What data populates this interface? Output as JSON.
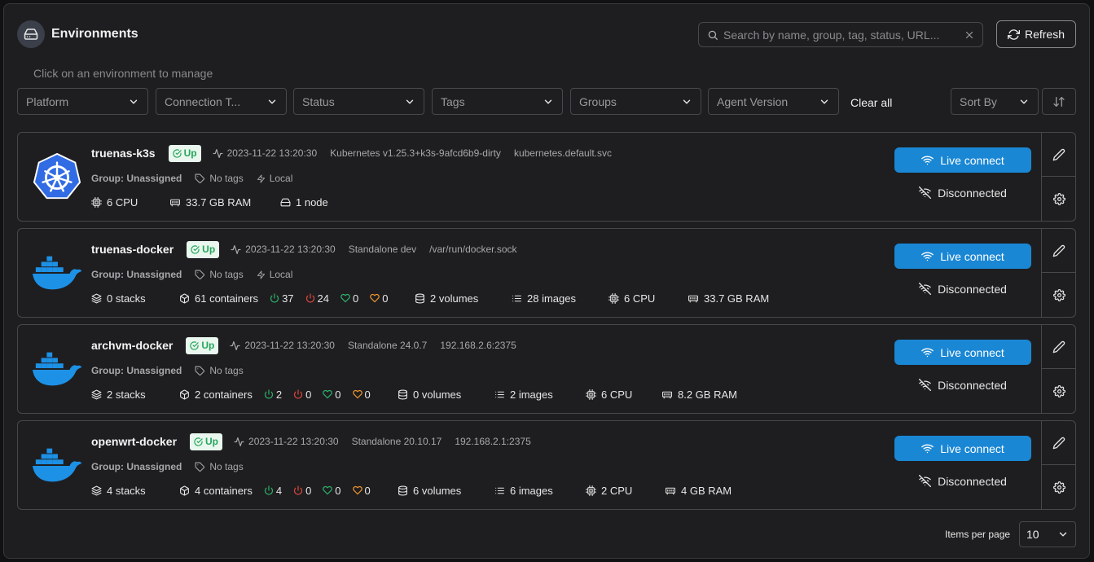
{
  "header": {
    "title": "Environments",
    "icon": "hard-drive-icon"
  },
  "search": {
    "placeholder": "Search by name, group, tag, status, URL..."
  },
  "refresh_label": "Refresh",
  "subtitle": "Click on an environment to manage",
  "filters": [
    "Platform",
    "Connection T...",
    "Status",
    "Tags",
    "Groups",
    "Agent Version"
  ],
  "clear_all": "Clear all",
  "sort_by": "Sort By",
  "environments": [
    {
      "name": "truenas-k3s",
      "logo": "kubernetes-logo",
      "status": "Up",
      "timestamp": "2023-11-22 13:20:30",
      "type": "Kubernetes v1.25.3+k3s-9afcd6b9-dirty",
      "url": "kubernetes.default.svc",
      "group": "Group: Unassigned",
      "tags": "No tags",
      "location": "Local",
      "resources": {
        "cpu": "6 CPU",
        "ram": "33.7 GB RAM",
        "nodes": "1 node"
      },
      "live_connect": "Live connect",
      "connection": "Disconnected"
    },
    {
      "name": "truenas-docker",
      "logo": "docker-logo",
      "status": "Up",
      "timestamp": "2023-11-22 13:20:30",
      "type": "Standalone dev",
      "url": "/var/run/docker.sock",
      "group": "Group: Unassigned",
      "tags": "No tags",
      "location": "Local",
      "resources": {
        "stacks": "0 stacks",
        "containers": "61 containers",
        "running": "37",
        "stopped": "24",
        "healthy": "0",
        "unhealthy": "0",
        "volumes": "2 volumes",
        "images": "28 images",
        "cpu": "6 CPU",
        "ram": "33.7 GB RAM"
      },
      "live_connect": "Live connect",
      "connection": "Disconnected"
    },
    {
      "name": "archvm-docker",
      "logo": "docker-logo",
      "status": "Up",
      "timestamp": "2023-11-22 13:20:30",
      "type": "Standalone 24.0.7",
      "url": "192.168.2.6:2375",
      "group": "Group: Unassigned",
      "tags": "No tags",
      "resources": {
        "stacks": "2 stacks",
        "containers": "2 containers",
        "running": "2",
        "stopped": "0",
        "healthy": "0",
        "unhealthy": "0",
        "volumes": "0 volumes",
        "images": "2 images",
        "cpu": "6 CPU",
        "ram": "8.2 GB RAM"
      },
      "live_connect": "Live connect",
      "connection": "Disconnected"
    },
    {
      "name": "openwrt-docker",
      "logo": "docker-logo",
      "status": "Up",
      "timestamp": "2023-11-22 13:20:30",
      "type": "Standalone 20.10.17",
      "url": "192.168.2.1:2375",
      "group": "Group: Unassigned",
      "tags": "No tags",
      "resources": {
        "stacks": "4 stacks",
        "containers": "4 containers",
        "running": "4",
        "stopped": "0",
        "healthy": "0",
        "unhealthy": "0",
        "volumes": "6 volumes",
        "images": "6 images",
        "cpu": "2 CPU",
        "ram": "4 GB RAM"
      },
      "live_connect": "Live connect",
      "connection": "Disconnected"
    }
  ],
  "pagination": {
    "label": "Items per page",
    "value": "10"
  },
  "colors": {
    "accent": "#1a87d4",
    "up": "#26a65b",
    "running": "#2db36a",
    "stopped": "#e0483e",
    "healthy": "#2db36a",
    "unhealthy": "#f0962e",
    "docker": "#1d91e6",
    "kubernetes": "#326ce5"
  }
}
